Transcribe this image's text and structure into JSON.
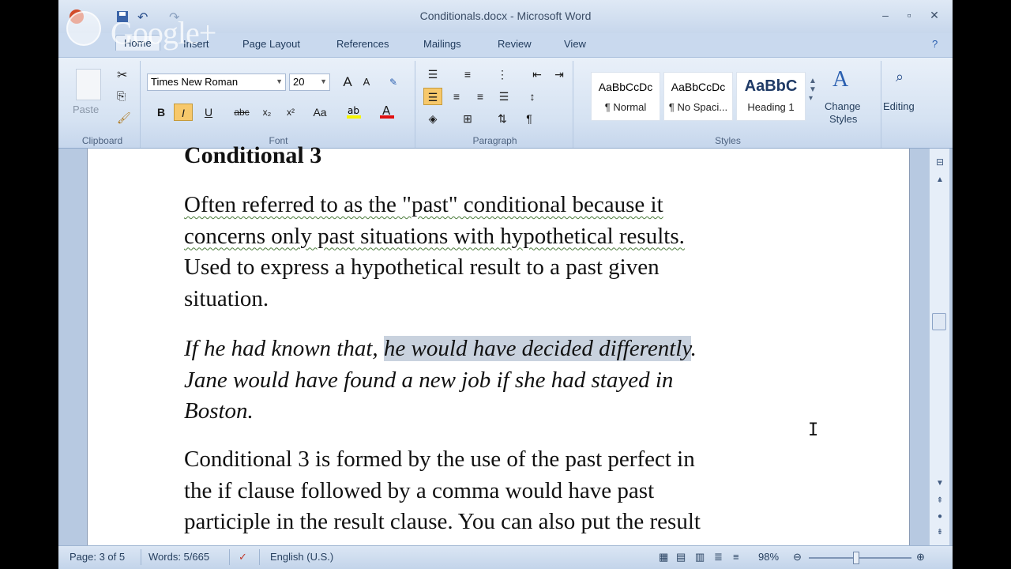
{
  "window": {
    "title": "Conditionals.docx - Microsoft Word",
    "controls": {
      "minimize": "–",
      "maximize": "▫",
      "close": "✕"
    }
  },
  "overlay": {
    "logo_text": "Google+"
  },
  "ribbon": {
    "tabs": [
      "Home",
      "Insert",
      "Page Layout",
      "References",
      "Mailings",
      "Review",
      "View"
    ],
    "active_tab": "Home",
    "clipboard": {
      "paste_label": "Paste",
      "group_label": "Clipboard"
    },
    "font": {
      "family": "Times New Roman",
      "size": "20",
      "buttons": {
        "bold": "B",
        "italic": "I",
        "underline": "U",
        "strike": "abc",
        "subscript": "x₂",
        "superscript": "x²",
        "change_case": "Aa",
        "grow": "A",
        "shrink": "A"
      },
      "group_label": "Font"
    },
    "paragraph": {
      "group_label": "Paragraph",
      "show_marks": "¶"
    },
    "styles": {
      "items": [
        {
          "preview": "AaBbCcDc",
          "name": "¶ Normal"
        },
        {
          "preview": "AaBbCcDc",
          "name": "¶ No Spaci..."
        },
        {
          "preview": "AaBbC",
          "name": "Heading 1"
        }
      ],
      "change_styles_line1": "Change",
      "change_styles_line2": "Styles",
      "group_label": "Styles"
    },
    "editing": {
      "label": "Editing"
    }
  },
  "document": {
    "heading": "Conditional 3",
    "p1_line1": "Often referred to as the \"past\" conditional because it",
    "p1_line2": "concerns only past situations with hypothetical results.",
    "p1_line3": "Used to express a hypothetical result to a past given",
    "p1_line4": "situation.",
    "ex_line1_pre": "If he had known that, ",
    "ex_line1_sel": "he would have decided differently",
    "ex_line1_post": ".",
    "ex_line2": "Jane would have found a new job if she had stayed in",
    "ex_line3": "Boston.",
    "p3_line1": "Conditional 3 is formed by the use of the past perfect in",
    "p3_line2": "the if clause followed by a comma would have past",
    "p3_line3": "participle in the result clause. You can also put the result"
  },
  "status": {
    "page": "Page: 3 of 5",
    "words": "Words: 5/665",
    "language": "English (U.S.)",
    "zoom": "98%"
  }
}
